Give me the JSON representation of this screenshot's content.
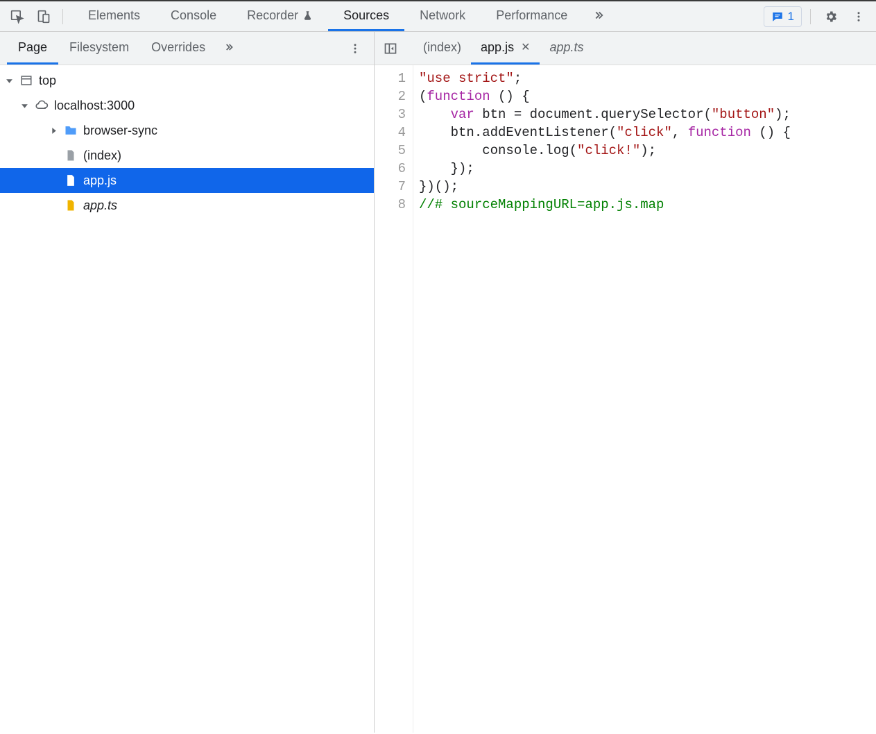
{
  "toolbar": {
    "main_tabs": [
      "Elements",
      "Console",
      "Recorder",
      "Sources",
      "Network",
      "Performance"
    ],
    "active_main_tab": "Sources",
    "recorder_experiment": true,
    "issue_count": "1"
  },
  "sources": {
    "left_tabs": [
      "Page",
      "Filesystem",
      "Overrides"
    ],
    "active_left_tab": "Page",
    "tree": {
      "top_label": "top",
      "origin_label": "localhost:3000",
      "items": [
        {
          "label": "browser-sync",
          "kind": "folder",
          "indent": 3,
          "caret": "right"
        },
        {
          "label": "(index)",
          "kind": "file-gray",
          "indent": 3
        },
        {
          "label": "app.js",
          "kind": "file-white",
          "indent": 3,
          "selected": true
        },
        {
          "label": "app.ts",
          "kind": "file-yellow",
          "indent": 3,
          "italic": true
        }
      ]
    }
  },
  "editor": {
    "tabs": [
      {
        "label": "(index)",
        "active": false,
        "closeable": false
      },
      {
        "label": "app.js",
        "active": true,
        "closeable": true
      },
      {
        "label": "app.ts",
        "active": false,
        "closeable": false,
        "italic": true
      }
    ],
    "code_lines": [
      [
        {
          "t": "str",
          "s": "\"use strict\""
        },
        {
          "t": "pun",
          "s": ";"
        }
      ],
      [
        {
          "t": "pun",
          "s": "("
        },
        {
          "t": "kw",
          "s": "function"
        },
        {
          "t": "pun",
          "s": " () {"
        }
      ],
      [
        {
          "t": "pun",
          "s": "    "
        },
        {
          "t": "kw",
          "s": "var"
        },
        {
          "t": "pun",
          "s": " btn = document.querySelector("
        },
        {
          "t": "str",
          "s": "\"button\""
        },
        {
          "t": "pun",
          "s": ");"
        }
      ],
      [
        {
          "t": "pun",
          "s": "    btn.addEventListener("
        },
        {
          "t": "str",
          "s": "\"click\""
        },
        {
          "t": "pun",
          "s": ", "
        },
        {
          "t": "kw",
          "s": "function"
        },
        {
          "t": "pun",
          "s": " () {"
        }
      ],
      [
        {
          "t": "pun",
          "s": "        console.log("
        },
        {
          "t": "str",
          "s": "\"click!\""
        },
        {
          "t": "pun",
          "s": ");"
        }
      ],
      [
        {
          "t": "pun",
          "s": "    });"
        }
      ],
      [
        {
          "t": "pun",
          "s": "})();"
        }
      ],
      [
        {
          "t": "cmt",
          "s": "//# sourceMappingURL=app.js.map"
        }
      ]
    ]
  }
}
